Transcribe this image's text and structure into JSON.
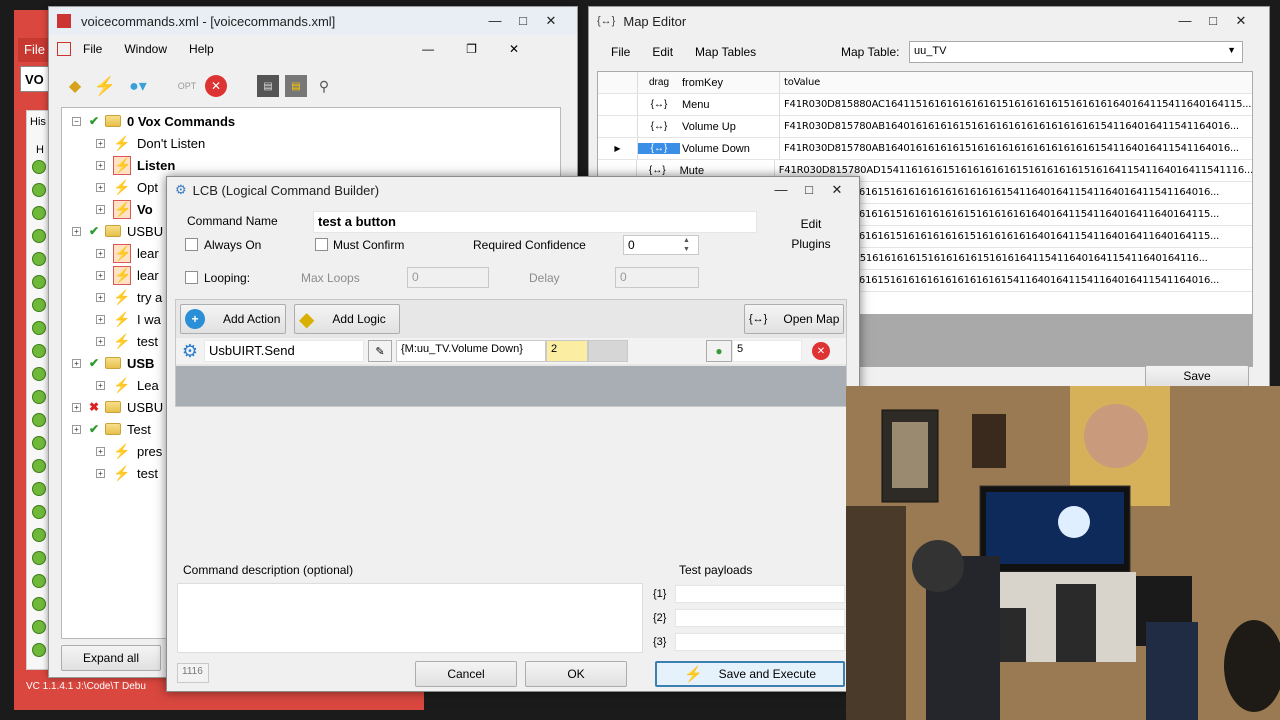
{
  "leftwin": {
    "title": "voicecommands.xml - [voicecommands.xml]",
    "menu": [
      "File",
      "Window",
      "Help"
    ],
    "tree": [
      {
        "label": "0 Vox Commands",
        "bold": true,
        "level": 0,
        "icon": "folder"
      },
      {
        "label": "Don't Listen",
        "level": 1,
        "icon": "bolt"
      },
      {
        "label": "Listen",
        "bold": true,
        "level": 1,
        "icon": "bolt-box"
      },
      {
        "label": "Opt",
        "level": 1,
        "icon": "bolt"
      },
      {
        "label": "Vo",
        "bold": true,
        "level": 1,
        "icon": "bolt-box"
      },
      {
        "label": "USBU",
        "level": 0,
        "icon": "folder"
      },
      {
        "label": "lear",
        "level": 1,
        "icon": "bolt-box"
      },
      {
        "label": "lear",
        "level": 1,
        "icon": "bolt-box"
      },
      {
        "label": "try a",
        "level": 1,
        "icon": "bolt"
      },
      {
        "label": "I wa",
        "level": 1,
        "icon": "bolt"
      },
      {
        "label": "test",
        "level": 1,
        "icon": "bolt"
      },
      {
        "label": "USB",
        "bold": true,
        "level": 0,
        "icon": "folder"
      },
      {
        "label": "Lea",
        "level": 1,
        "icon": "bolt"
      },
      {
        "label": "USBU",
        "level": 0,
        "icon": "folder",
        "x": true
      },
      {
        "label": "Test",
        "level": 0,
        "icon": "folder"
      },
      {
        "label": "pres",
        "level": 1,
        "icon": "bolt"
      },
      {
        "label": "test",
        "level": 1,
        "icon": "bolt"
      }
    ],
    "expand_all": "Expand all",
    "status": "VC 1.1.4.1 J:\\Code\\T Debu",
    "outer_menu": "File",
    "outer_field": "VO",
    "outer_his": "His",
    "outer_h": "H"
  },
  "mapeditor": {
    "title": "Map Editor",
    "menu": [
      "File",
      "Edit",
      "Map Tables"
    ],
    "map_table_label": "Map Table:",
    "map_table_value": "uu_TV",
    "columns": [
      "drag",
      "fromKey",
      "toValue"
    ],
    "rows": [
      {
        "key": "Menu",
        "value": "F41R030D815880AC1641151616161616161516161616151616161640164115411640164115..."
      },
      {
        "key": "Volume Up",
        "value": "F41R030D815780AB16401616161615161616161616161616161541164016411541164016..."
      },
      {
        "key": "Volume Down",
        "value": "F41R030D815780AB16401616161615161616161616161616161541164016411541164016...",
        "selected": true
      },
      {
        "key": "Mute",
        "value": "F41R030D815780AD15411616161516161616161516161616151616411541164016411541116..."
      },
      {
        "key": "",
        "value": "0AB164016161616151616161616161616161541164016411541164016411541164016..."
      },
      {
        "key": "",
        "value": "0AC164115161616161516161616161516161616164016411541164016411640164115..."
      },
      {
        "key": "",
        "value": "0AC164115161616161516161616161516161616164016411541164016411640164115..."
      },
      {
        "key": "",
        "value": "0AD1541161615161616161516161616151616164115411640164115411640164116..."
      },
      {
        "key": "",
        "value": "0AB164016161616151616161616161616161541164016411541164016411541164016..."
      }
    ],
    "save": "Save"
  },
  "lcb": {
    "title": "LCB (Logical Command Builder)",
    "command_name_label": "Command Name",
    "command_name": "test a button",
    "edit_plugins": "Edit\nPlugins",
    "always_on": "Always On",
    "must_confirm": "Must Confirm",
    "required_confidence_label": "Required Confidence",
    "required_confidence": "0",
    "looping": "Looping:",
    "max_loops_label": "Max Loops",
    "max_loops": "0",
    "delay_label": "Delay",
    "delay": "0",
    "add_action": "Add Action",
    "add_logic": "Add Logic",
    "open_map": "Open Map",
    "action": {
      "plugin": "UsbUIRT.Send",
      "param1": "{M:uu_TV.Volume Down}",
      "param2": "2",
      "param3": "",
      "count": "5"
    },
    "description_label": "Command description (optional)",
    "test_payloads_label": "Test payloads",
    "payloads": [
      "{1}",
      "{2}",
      "{3}"
    ],
    "id": "1116",
    "cancel": "Cancel",
    "ok": "OK",
    "save_execute": "Save and Execute"
  },
  "colors": {
    "accent": "#cde6f7",
    "selected": "#3a8ee6",
    "taskbar": "#d63939"
  }
}
